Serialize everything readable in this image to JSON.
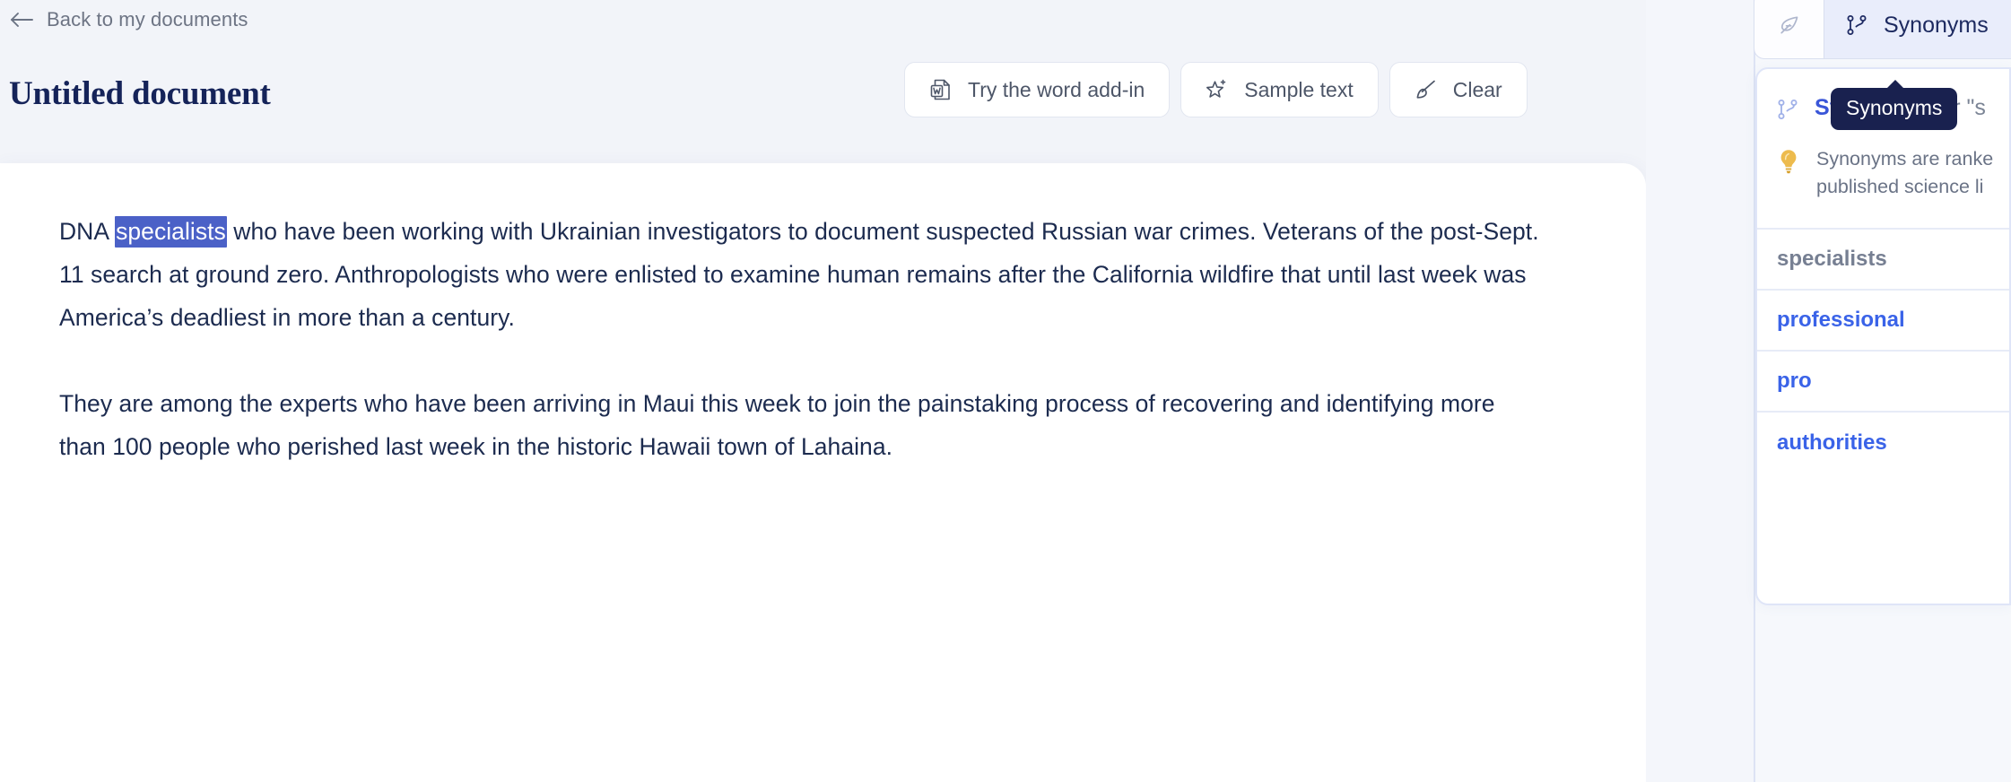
{
  "header": {
    "back_label": "Back to my documents",
    "back_icon": "arrow-left-icon",
    "doc_title": "Untitled document"
  },
  "toolbar": {
    "buttons": [
      {
        "label": "Try the word add-in",
        "icon": "word-document-icon"
      },
      {
        "label": "Sample text",
        "icon": "sparkle-star-icon"
      },
      {
        "label": "Clear",
        "icon": "brush-clear-icon"
      }
    ]
  },
  "document": {
    "paragraph_1": {
      "before_selection": "DNA ",
      "selection": "specialists",
      "after_selection": " who have been working with Ukrainian investigators to document suspected Russian war crimes. Veterans of the post-Sept. 11 search at ground zero. Anthropologists who were enlisted to examine human remains after the California wildfire that until last week was America’s deadliest in more than a century."
    },
    "paragraph_2": "They are among the experts who have been arriving in Maui this week to join the painstaking process of recovering and identifying more than 100 people who perished last week in the historic Hawaii town of Lahaina."
  },
  "right_panel": {
    "tabs": [
      {
        "label": "",
        "icon": "feather-quill-icon",
        "active": false
      },
      {
        "label": "Synonyms",
        "icon": "branch-synonyms-icon",
        "active": true
      }
    ],
    "tooltip": "Synonyms",
    "card": {
      "title_strong": "Synonyms",
      "title_rest": " for \"s",
      "title_icon": "branch-synonyms-icon",
      "hint_icon": "lightbulb-icon",
      "hint": "Synonyms are ranke published science li",
      "items": [
        {
          "word": "specialists",
          "state": "current"
        },
        {
          "word": "professional",
          "state": "link"
        },
        {
          "word": "pro",
          "state": "link"
        },
        {
          "word": "authorities",
          "state": "link"
        }
      ]
    }
  },
  "colors": {
    "page_bg": "#f2f4f9",
    "title_navy": "#152359",
    "selection_blue": "#4b61c7",
    "link_blue": "#3a63e8",
    "tooltip_navy": "#19214f",
    "bulb_yellow": "#e9b33c"
  }
}
